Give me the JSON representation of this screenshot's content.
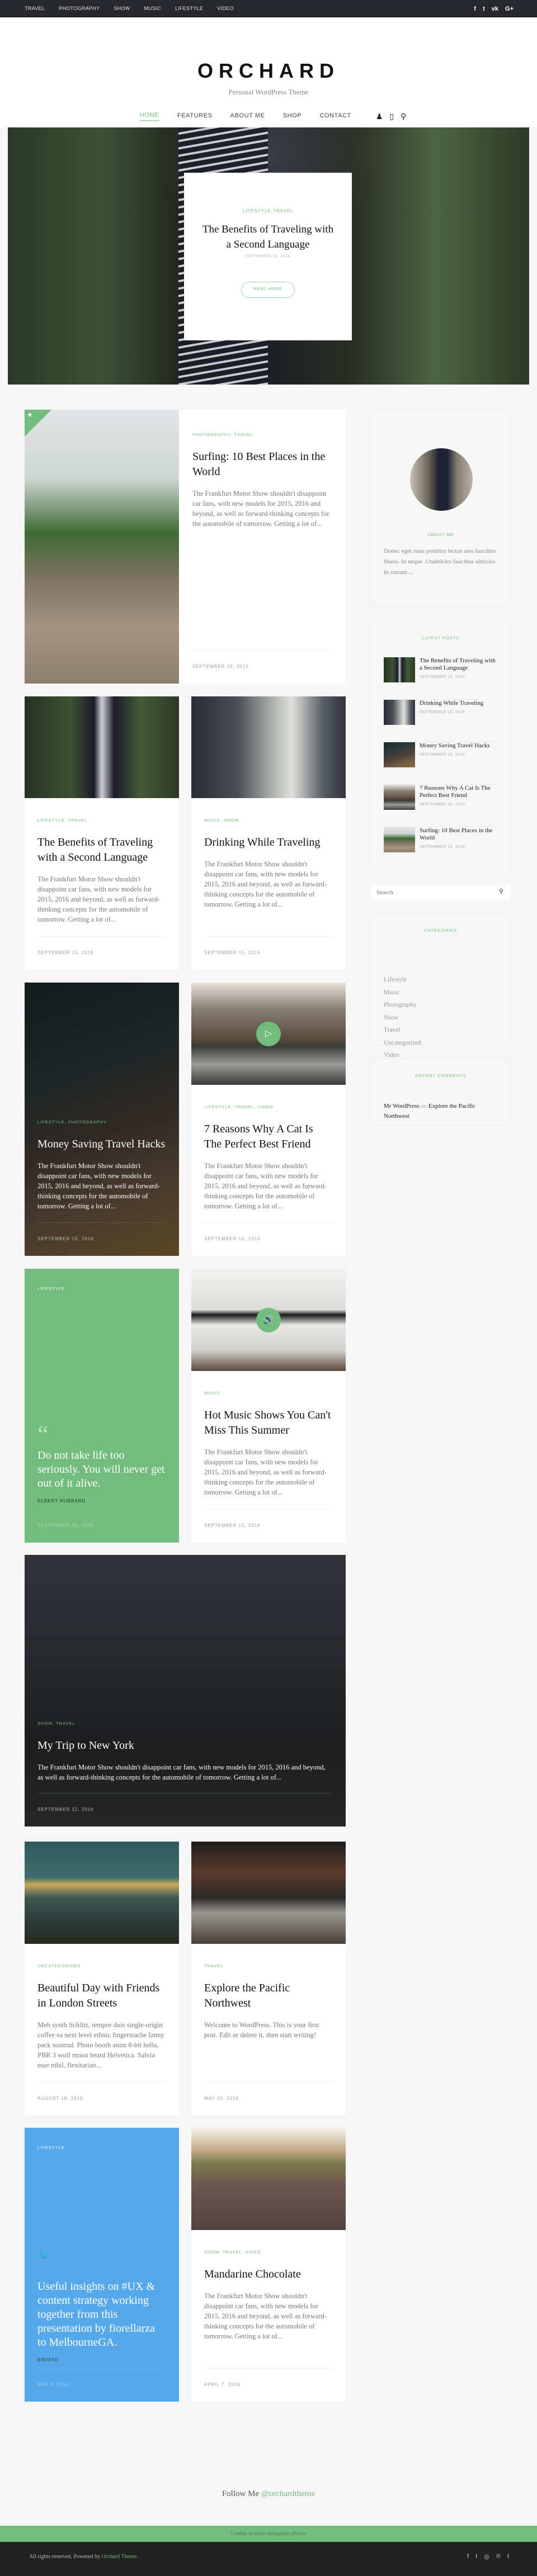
{
  "topbar": {
    "nav": [
      "TRAVEL",
      "PHOTOGRAPHY",
      "SHOW",
      "MUSIC",
      "LIFESTYLE",
      "VIDEO"
    ],
    "social": [
      {
        "icon": "facebook-icon",
        "glyph": "f"
      },
      {
        "icon": "twitter-icon",
        "glyph": "t"
      },
      {
        "icon": "vk-icon",
        "glyph": "vk"
      },
      {
        "icon": "google-plus-icon",
        "glyph": "G+"
      }
    ]
  },
  "header": {
    "logo": "ORCHARD",
    "tagline": "Personal WordPress Theme",
    "nav": [
      {
        "label": "HOME",
        "active": true
      },
      {
        "label": "FEATURES"
      },
      {
        "label": "ABOUT ME"
      },
      {
        "label": "SHOP"
      },
      {
        "label": "CONTACT"
      }
    ],
    "icons": [
      "user-icon",
      "shopping-bag-icon",
      "search-icon"
    ]
  },
  "hero": {
    "category": "LIFESTYLE,TRAVEL",
    "title": "The Benefits of Traveling with a Second Language",
    "date": "SEPTEMBER 15, 2016",
    "button": "READ MORE"
  },
  "posts": [
    {
      "type": "side",
      "featured": true,
      "category": "PHOTOGRAPHY, TRAVEL",
      "title": "Surfing: 10 Best Places in the World",
      "excerpt": "The Frankfurt Motor Show shouldn't disappoint car fans, with new models for 2015, 2016 and beyond, as well as forward-thinking concepts for the automobile of tomorrow. Getting a lot of...",
      "date": "SEPTEMBER 15, 2016"
    },
    {
      "type": "standard",
      "category": "LIFESTYLE, TRAVEL",
      "title": "The Benefits of Traveling with a Second Language",
      "excerpt": "The Frankfurt Motor Show shouldn't disappoint car fans, with new models for 2015, 2016 and beyond, as well as forward-thinking concepts for the automobile of tomorrow. Getting a lot of...",
      "date": "SEPTEMBER 15, 2016"
    },
    {
      "type": "standard",
      "category": "MUSIC, SHOW",
      "title": "Drinking While Traveling",
      "excerpt": "The Frankfurt Motor Show shouldn't disappoint car fans, with new models for 2015, 2016 and beyond, as well as forward-thinking concepts for the automobile of tomorrow. Getting a lot of...",
      "date": "SEPTEMBER 15, 2016"
    },
    {
      "type": "overlay",
      "category": "LIFESTYLE, PHOTOGRAPHY",
      "title": "Money Saving Travel Hacks",
      "excerpt": "The Frankfurt Motor Show shouldn't disappoint car fans, with new models for 2015, 2016 and beyond, as well as forward-thinking concepts for the automobile of tomorrow. Getting a lot of...",
      "date": "SEPTEMBER 15, 2016"
    },
    {
      "type": "standard",
      "media": "play-icon",
      "category": "LIFESTYLE, TRAVEL, VIDEO",
      "title": "7 Reasons Why A Cat Is The Perfect Best Friend",
      "excerpt": "The Frankfurt Motor Show shouldn't disappoint car fans, with new models for 2015, 2016 and beyond, as well as forward-thinking concepts for the automobile of tomorrow. Getting a lot of...",
      "date": "SEPTEMBER 15, 2016"
    },
    {
      "type": "quote",
      "category": "LIFESTYLE",
      "quote": "Do not take life too seriously. You will never get out of it alive.",
      "author": "ELBERT HUBBARD",
      "date": "SEPTEMBER 15, 2016"
    },
    {
      "type": "standard",
      "media": "audio-icon",
      "category": "MUSIC",
      "title": "Hot Music Shows You Can't Miss This Summer",
      "excerpt": "The Frankfurt Motor Show shouldn't disappoint car fans, with new models for 2015, 2016 and beyond, as well as forward-thinking concepts for the automobile of tomorrow. Getting a lot of...",
      "date": "SEPTEMBER 15, 2016"
    },
    {
      "type": "overlay",
      "category": "SHOW, TRAVEL",
      "title": "My Trip to New York",
      "excerpt": "The Frankfurt Motor Show shouldn't disappoint car fans, with new models for 2015, 2016 and beyond, as well as forward-thinking concepts for the automobile of tomorrow. Getting a lot of...",
      "date": "SEPTEMBER 12, 2016"
    },
    {
      "type": "standard",
      "category": "UNCATEGORIZED",
      "title": "Beautiful Day with Friends in London Streets",
      "excerpt": "Meh synth Schlitz, tempor duis single-origin coffee ea next level ethnic fingerstache fanny pack nostrud. Photo booth anim 8-bit hella, PBR 3 wolf moon beard Helvetica. Salvia esse nihil, flexitarian...",
      "date": "AUGUST 18, 2016"
    },
    {
      "type": "standard",
      "category": "TRAVEL",
      "title": "Explore the Pacific Northwest",
      "excerpt": "Welcome to WordPress. This is your first post. Edit or delete it, then start writing!",
      "date": "MAY 10, 2016"
    },
    {
      "type": "tweet",
      "category": "LIFESTYLE",
      "quote": "Useful insights on #UX & content strategy working together from this presentation by fiorellarza to MelbourneGA.",
      "author": "ENVATO",
      "date": "MAY 9, 2016"
    },
    {
      "type": "standard",
      "category": "SHOW, TRAVEL, VIDEO",
      "title": "Mandarine Chocolate",
      "excerpt": "The Frankfurt Motor Show shouldn't disappoint car fans, with new models for 2015, 2016 and beyond, as well as forward-thinking concepts for the automobile of tomorrow. Getting a lot of...",
      "date": "APRIL 7, 2016"
    }
  ],
  "sidebar": {
    "about": {
      "title": "ABOUT ME",
      "text": "Donec eget risus porttitor lectus ates faucibus libero. In neque .Utultricies faucibus ultricies. In rutrum ..."
    },
    "latest": {
      "title": "LATEST POSTS",
      "items": [
        {
          "title": "The Benefits of Traveling with a Second Language",
          "date": "SEPTEMBER 15, 2016"
        },
        {
          "title": "Drinking While Traveling",
          "date": "SEPTEMBER 15, 2016"
        },
        {
          "title": "Money Saving Travel Hacks",
          "date": "SEPTEMBER 15, 2016"
        },
        {
          "title": "7 Reasons Why A Cat Is The Perfect Best Friend",
          "date": "SEPTEMBER 15, 2016"
        },
        {
          "title": "Surfing: 10 Best Places in the World",
          "date": "SEPTEMBER 15, 2016"
        }
      ]
    },
    "search": {
      "placeholder": "Search"
    },
    "categories": {
      "title": "CATEGORIES",
      "items": [
        "Lifestyle",
        "Music",
        "Photography",
        "Show",
        "Travel",
        "Uncategorized",
        "Video"
      ]
    },
    "comments": {
      "title": "RECENT COMMENTS",
      "author": "Mr WordPress",
      "on": "on",
      "post": "Explore the Pacific Northwest"
    }
  },
  "footer": {
    "follow_label": "Follow Me",
    "follow_handle": "@orchardtheme",
    "instagram_message": "Unable to show Instagram photos",
    "copyright": "All rights reserved. Powered by",
    "copyright_link": "Orchard Theme",
    "copyright_end": ".",
    "social": [
      {
        "icon": "facebook-icon",
        "glyph": "f"
      },
      {
        "icon": "twitter-icon",
        "glyph": "t"
      },
      {
        "icon": "instagram-icon",
        "glyph": "◎"
      },
      {
        "icon": "pinterest-icon",
        "glyph": "℗"
      },
      {
        "icon": "tumblr-icon",
        "glyph": "t"
      }
    ]
  },
  "colors": {
    "accent": "#72bc7e",
    "tweet": "#55a8ea",
    "topbar": "#27282d",
    "footer": "#212121",
    "background": "#f6f6f6"
  }
}
